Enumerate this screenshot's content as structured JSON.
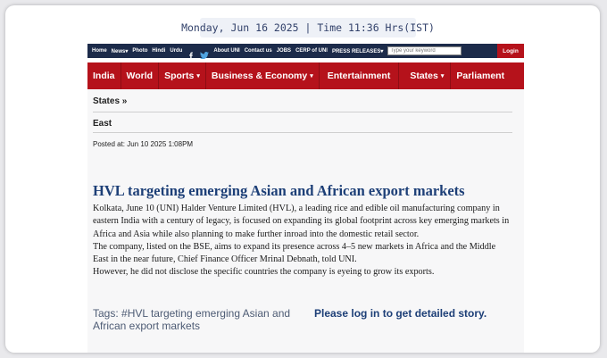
{
  "datebar": "Monday, Jun 16 2025 | Time 11:36 Hrs(IST)",
  "topnav": {
    "home": "Home",
    "news": "News",
    "photo": "Photo",
    "hindi": "Hindi",
    "urdu": "Urdu",
    "about": "About UNI",
    "contact": "Contact us",
    "jobs": "JOBS",
    "cerp": "CERP of UNI",
    "press": "PRESS RELEASES",
    "search_placeholder": "Type your keyword",
    "login": "Login",
    "caret": "▾",
    "icons": [
      "facebook-icon",
      "twitter-icon"
    ],
    "colors": {
      "bar": "#1c2b4a",
      "login": "#b5121b"
    }
  },
  "mainnav": {
    "items": [
      "India",
      "World",
      "Sports",
      "Business & Economy",
      "Entertainment",
      "States",
      "Parliament"
    ],
    "caret": "▾",
    "color": "#b5121b"
  },
  "breadcrumb": {
    "section": "States »",
    "region": "East"
  },
  "posted": "Posted at: Jun 10 2025 1:08PM",
  "article": {
    "headline": "HVL targeting emerging Asian and African export markets",
    "paragraphs": [
      "Kolkata, June 10 (UNI) Halder Venture Limited (HVL), a leading rice and edible oil manufacturing company in eastern India with a century of legacy, is focused on expanding its global footprint across key emerging markets in Africa and Asia while also planning to make further inroad into the domestic retail sector.",
      "The company, listed on the BSE, aims to expand its presence across 4–5 new markets in Africa and the Middle East in the near future, Chief Finance Officer Mrinal Debnath, told UNI.",
      "However, he did not disclose the specific countries the company is eyeing to grow its exports."
    ]
  },
  "tags": {
    "label": "Tags:",
    "items": [
      "#HVL targeting emerging Asian and African export markets"
    ]
  },
  "login_prompt": "Please log in to get detailed story."
}
